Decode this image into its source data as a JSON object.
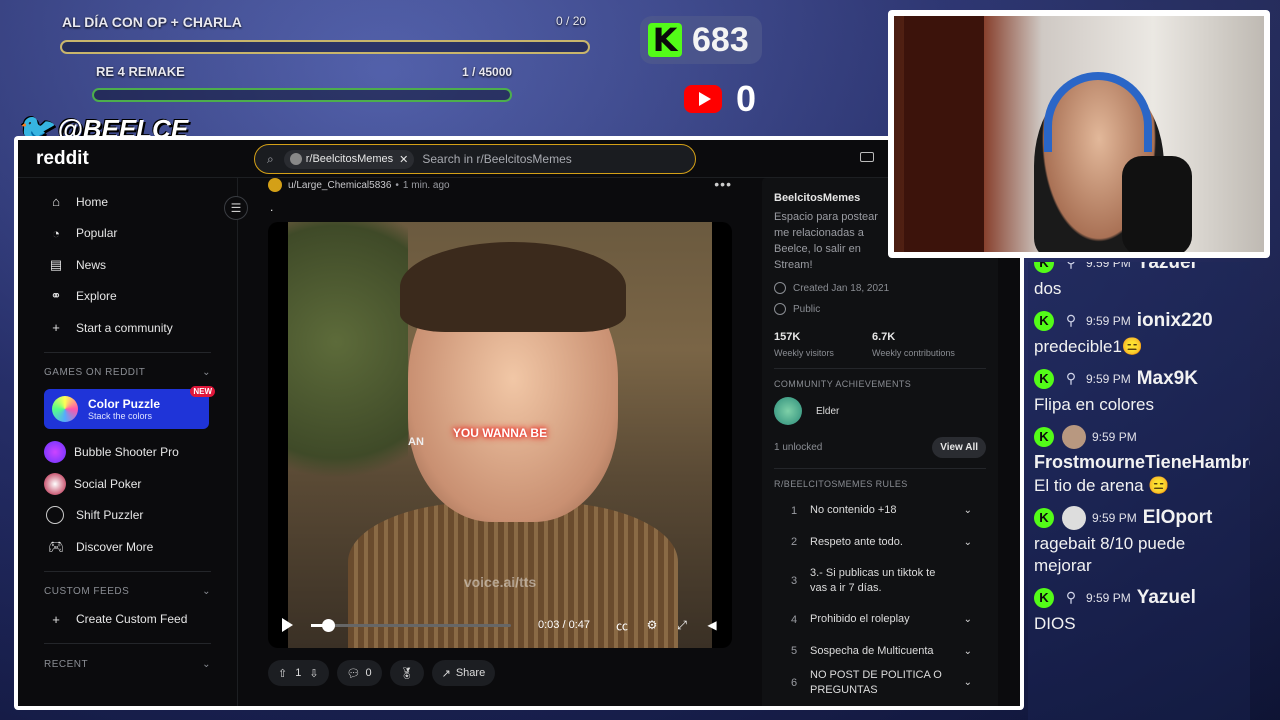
{
  "overlay": {
    "goal1": {
      "label": "AL DÍA CON OP + CHARLA",
      "current": "0",
      "target": "20",
      "progress": 0
    },
    "goal2": {
      "label": "RE 4 REMAKE",
      "current": "1",
      "target": "45000",
      "progress": 2e-05
    },
    "kick_followers": "683",
    "youtube_count": "0",
    "twitter_handle": "@BEELCE_",
    "colors": {
      "kick": "#53fc18",
      "youtube": "#ff0000",
      "goal_bar": "#c8b56c",
      "goal_bar2": "#4cae4c"
    }
  },
  "reddit": {
    "brand": "reddit",
    "search": {
      "chip": "r/BeelcitosMemes",
      "placeholder": "Search in r/BeelcitosMemes"
    },
    "nav": [
      {
        "label": "Home",
        "icon": "home-icon"
      },
      {
        "label": "Popular",
        "icon": "popular-icon"
      },
      {
        "label": "News",
        "icon": "news-icon"
      },
      {
        "label": "Explore",
        "icon": "explore-icon"
      },
      {
        "label": "Start a community",
        "icon": "plus-icon"
      }
    ],
    "games_heading": "GAMES ON REDDIT",
    "featured_game": {
      "title": "Color Puzzle",
      "subtitle": "Stack the colors",
      "badge": "NEW"
    },
    "games": [
      {
        "label": "Bubble Shooter Pro"
      },
      {
        "label": "Social Poker"
      },
      {
        "label": "Shift Puzzler"
      },
      {
        "label": "Discover More"
      }
    ],
    "custom_feeds_heading": "CUSTOM FEEDS",
    "create_feed": "Create Custom Feed",
    "recent_heading": "RECENT",
    "post": {
      "author": "u/Large_Chemical5836",
      "time": "1 min. ago",
      "title": ".",
      "caption": "YOU WANNA BE",
      "caption_left": "AN",
      "watermark": "voice.ai/tts",
      "video_time": "0:03 / 0:47",
      "video_progress": 0.064,
      "votes": "1",
      "comments": "0",
      "share": "Share"
    },
    "sidebar_right": {
      "name": "BeelcitosMemes",
      "description": "Espacio para postear me relacionadas a Beelce, lo salir en Stream!",
      "created": "Created Jan 18, 2021",
      "visibility": "Public",
      "stats": [
        {
          "value": "157K",
          "label": "Weekly visitors"
        },
        {
          "value": "6.7K",
          "label": "Weekly contributions"
        }
      ],
      "achievements_heading": "COMMUNITY ACHIEVEMENTS",
      "achievement": "Elder",
      "unlocked": "1 unlocked",
      "view_all": "View All",
      "rules_heading": "R/BEELCITOSMEMES RULES",
      "rules": [
        {
          "n": "1",
          "text": "No contenido +18"
        },
        {
          "n": "2",
          "text": "Respeto ante todo."
        },
        {
          "n": "3",
          "text": "3.- Si publicas un tiktok te vas a ir 7 días."
        },
        {
          "n": "4",
          "text": "Prohibido el roleplay"
        },
        {
          "n": "5",
          "text": "Sospecha de Multicuenta"
        },
        {
          "n": "6",
          "text": "NO POST DE POLITICA O PREGUNTAS"
        }
      ]
    }
  },
  "chat": [
    {
      "time": "9:59 PM",
      "user": "Yazuel",
      "text": "dos"
    },
    {
      "time": "9:59 PM",
      "user": "ionix220",
      "text": "predecible1😑"
    },
    {
      "time": "9:59 PM",
      "user": "Max9K",
      "text": "Flipa en colores"
    },
    {
      "time": "9:59 PM",
      "user": "FrostmourneTieneHambre",
      "text": "El tio de arena 😑"
    },
    {
      "time": "9:59 PM",
      "user": "ElOport",
      "text": "ragebait 8/10 puede mejorar"
    },
    {
      "time": "9:59 PM",
      "user": "Yazuel",
      "text": "DIOS"
    }
  ]
}
